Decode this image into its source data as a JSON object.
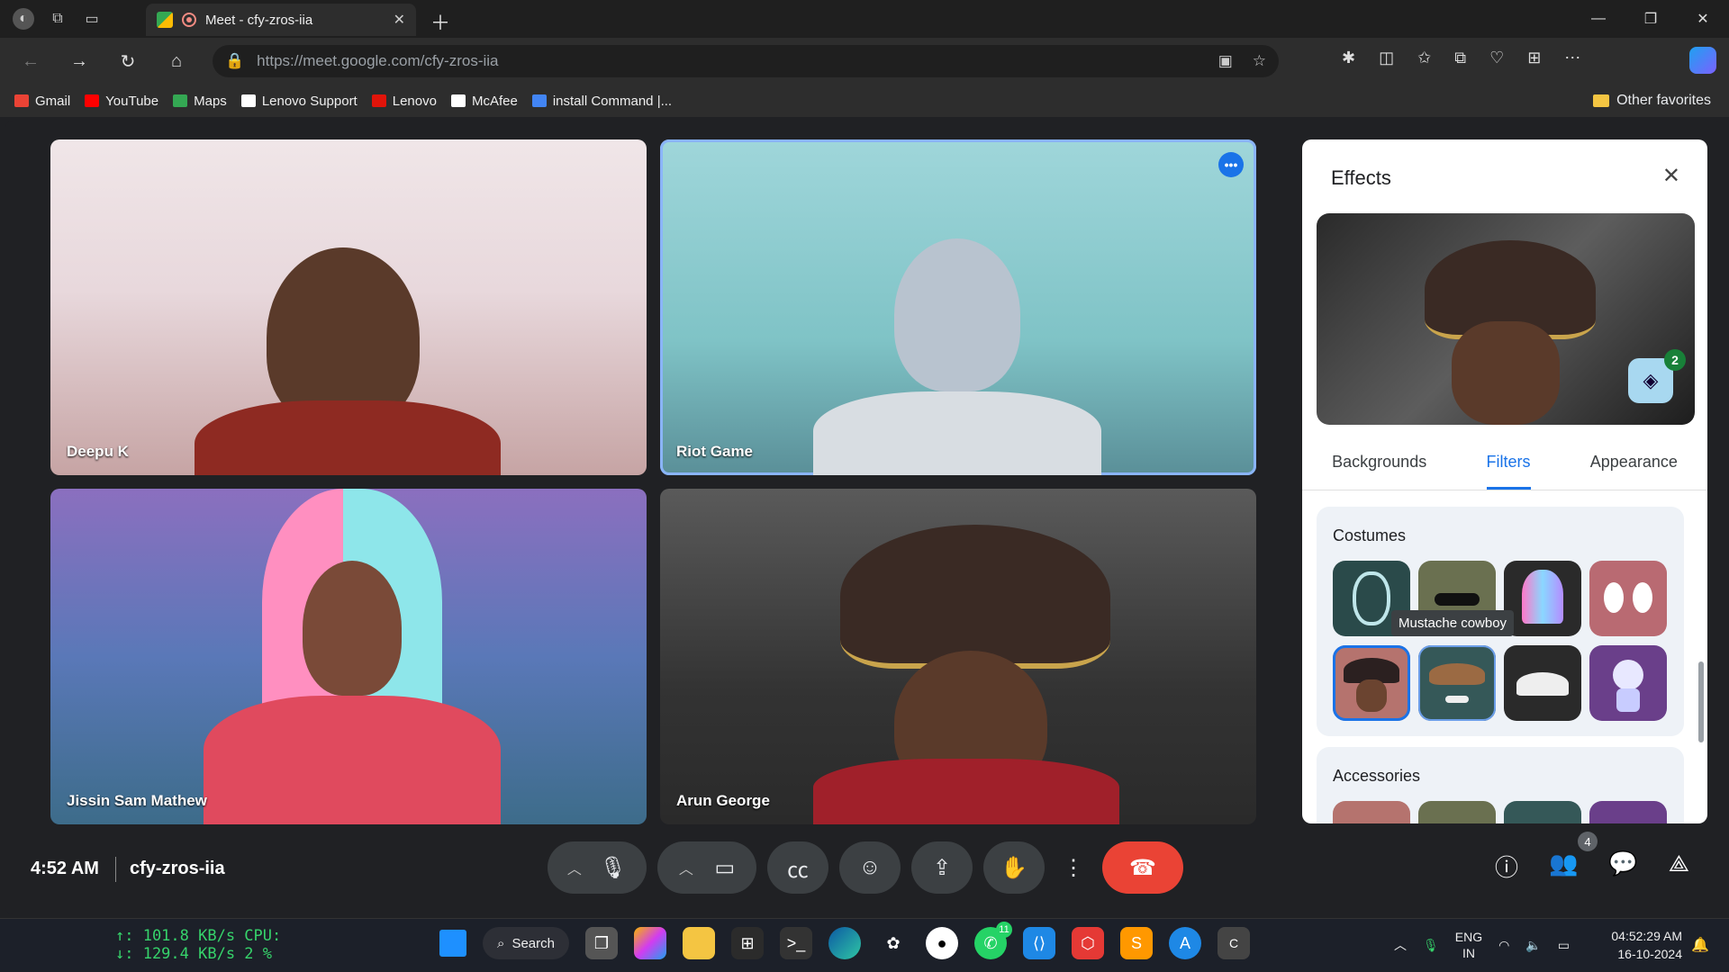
{
  "browser": {
    "tab_title": "Meet - cfy-zros-iia",
    "url_host": "https://meet.google.com/",
    "url_path": "cfy-zros-iia",
    "favorites": [
      {
        "label": "Gmail",
        "color": "#ea4335"
      },
      {
        "label": "YouTube",
        "color": "#ff0000"
      },
      {
        "label": "Maps",
        "color": "#34a853"
      },
      {
        "label": "Lenovo Support",
        "color": "#ffffff"
      },
      {
        "label": "Lenovo",
        "color": "#e1140a"
      },
      {
        "label": "McAfee",
        "color": "#ffffff"
      },
      {
        "label": "install Command |...",
        "color": "#4285f4"
      }
    ],
    "other_favorites": "Other favorites"
  },
  "participants": [
    {
      "name": "Deepu K"
    },
    {
      "name": "Riot Game"
    },
    {
      "name": "Jissin Sam Mathew"
    },
    {
      "name": "Arun George"
    }
  ],
  "effects_panel": {
    "title": "Effects",
    "layers_count": "2",
    "tabs": [
      "Backgrounds",
      "Filters",
      "Appearance"
    ],
    "active_tab": "Filters",
    "section_costumes": "Costumes",
    "section_accessories": "Accessories",
    "tooltip": "Mustache cowboy"
  },
  "meeting_bar": {
    "time": "4:52 AM",
    "code": "cfy-zros-iia",
    "participant_count": "4"
  },
  "taskbar": {
    "net_up": "↑: 101.8 KB/s CPU:",
    "net_down": "↓: 129.4 KB/s   2 %",
    "search_label": "Search",
    "whatsapp_badge": "11",
    "lang_line1": "ENG",
    "lang_line2": "IN",
    "clock_time": "04:52:29 AM",
    "clock_date": "16-10-2024"
  },
  "colors": {
    "accent_blue": "#1a73e8",
    "end_call_red": "#ea4335"
  }
}
